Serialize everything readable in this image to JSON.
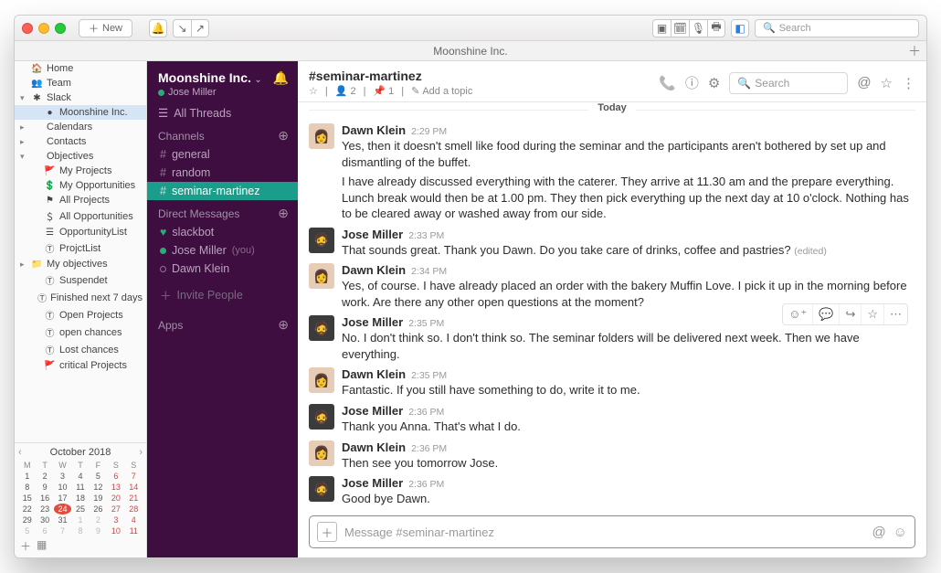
{
  "toolbar": {
    "new_label": "New",
    "search_placeholder": "Search"
  },
  "window_title": "Moonshine Inc.",
  "outline": {
    "items": [
      {
        "label": "Home",
        "icon": "home",
        "level": 0
      },
      {
        "label": "Team",
        "icon": "team",
        "level": 0
      },
      {
        "label": "Slack",
        "icon": "slack",
        "level": 0,
        "expanded": true
      },
      {
        "label": "Moonshine Inc.",
        "icon": "slack-ws",
        "level": 1,
        "selected": true
      },
      {
        "label": "Calendars",
        "icon": "",
        "level": 0,
        "collapsed": true
      },
      {
        "label": "Contacts",
        "icon": "",
        "level": 0,
        "collapsed": true
      },
      {
        "label": "Objectives",
        "icon": "",
        "level": 0,
        "expanded": true
      },
      {
        "label": "My Projects",
        "icon": "flag",
        "level": 1
      },
      {
        "label": "My Opportunities",
        "icon": "dollar",
        "level": 1
      },
      {
        "label": "All Projects",
        "icon": "flag-grey",
        "level": 1
      },
      {
        "label": "All Opportunities",
        "icon": "dollar-grey",
        "level": 1
      },
      {
        "label": "OpportunityList",
        "icon": "list",
        "level": 1
      },
      {
        "label": "ProjctList",
        "icon": "tlist",
        "level": 1
      },
      {
        "label": "My objectives",
        "icon": "folder",
        "level": 0,
        "collapsed": true
      },
      {
        "label": "Suspendet",
        "icon": "tlist",
        "level": 1
      },
      {
        "label": "Finished next 7 days",
        "icon": "tlist",
        "level": 1
      },
      {
        "label": "Open Projects",
        "icon": "tlist",
        "level": 1
      },
      {
        "label": "open chances",
        "icon": "tlist",
        "level": 1
      },
      {
        "label": "Lost chances",
        "icon": "tlist",
        "level": 1
      },
      {
        "label": "critical Projects",
        "icon": "flag-red",
        "level": 1
      }
    ]
  },
  "calendar": {
    "title": "October 2018",
    "dow": [
      "M",
      "T",
      "W",
      "T",
      "F",
      "S",
      "S"
    ],
    "weeks": [
      [
        {
          "d": 1,
          "we": false
        },
        {
          "d": 2
        },
        {
          "d": 3
        },
        {
          "d": 4
        },
        {
          "d": 5
        },
        {
          "d": 6,
          "we": true
        },
        {
          "d": 7,
          "we": true
        }
      ],
      [
        {
          "d": 8
        },
        {
          "d": 9
        },
        {
          "d": 10
        },
        {
          "d": 11
        },
        {
          "d": 12
        },
        {
          "d": 13,
          "we": true
        },
        {
          "d": 14,
          "we": true
        }
      ],
      [
        {
          "d": 15
        },
        {
          "d": 16
        },
        {
          "d": 17
        },
        {
          "d": 18
        },
        {
          "d": 19
        },
        {
          "d": 20,
          "we": true
        },
        {
          "d": 21,
          "we": true
        }
      ],
      [
        {
          "d": 22
        },
        {
          "d": 23
        },
        {
          "d": 24,
          "today": true
        },
        {
          "d": 25
        },
        {
          "d": 26
        },
        {
          "d": 27,
          "we": true
        },
        {
          "d": 28,
          "we": true
        }
      ],
      [
        {
          "d": 29
        },
        {
          "d": 30
        },
        {
          "d": 31
        },
        {
          "d": 1,
          "dim": true
        },
        {
          "d": 2,
          "dim": true
        },
        {
          "d": 3,
          "dim": true,
          "we": true
        },
        {
          "d": 4,
          "dim": true,
          "we": true
        }
      ],
      [
        {
          "d": 5,
          "dim": true
        },
        {
          "d": 6,
          "dim": true
        },
        {
          "d": 7,
          "dim": true
        },
        {
          "d": 8,
          "dim": true
        },
        {
          "d": 9,
          "dim": true
        },
        {
          "d": 10,
          "dim": true,
          "we": true
        },
        {
          "d": 11,
          "dim": true,
          "we": true
        }
      ]
    ]
  },
  "slack": {
    "workspace": "Moonshine Inc.",
    "user": "Jose Miller",
    "all_threads": "All Threads",
    "channels_label": "Channels",
    "channels": [
      {
        "name": "general"
      },
      {
        "name": "random"
      },
      {
        "name": "seminar-martinez",
        "active": true
      }
    ],
    "dm_label": "Direct Messages",
    "dms": [
      {
        "name": "slackbot",
        "icon": "heart"
      },
      {
        "name": "Jose Miller",
        "suffix": "(you)",
        "presence": "on"
      },
      {
        "name": "Dawn Klein",
        "presence": "off"
      }
    ],
    "invite_label": "Invite People",
    "apps_label": "Apps"
  },
  "channel_header": {
    "name": "#seminar-martinez",
    "members": "2",
    "pins": "1",
    "topic": "Add a topic",
    "search_placeholder": "Search"
  },
  "divider_label": "Today",
  "messages": [
    {
      "author": "Dawn Klein",
      "avatar": "dawn",
      "time": "2:29 PM",
      "paragraphs": [
        "Yes, then it doesn't smell like food during the seminar and the participants aren't bothered by set up and dismantling of the buffet.",
        "I have already discussed everything with the caterer. They arrive at 11.30 am and the prepare everything. Lunch break would then be at 1.00 pm. They then pick everything up the next day at 10 o'clock. Nothing has to be cleared away or washed away from our side."
      ]
    },
    {
      "author": "Jose Miller",
      "avatar": "jose",
      "time": "2:33 PM",
      "paragraphs": [
        "That sounds great. Thank you Dawn. Do you take care of drinks, coffee and pastries?"
      ],
      "edited": true
    },
    {
      "author": "Dawn Klein",
      "avatar": "dawn",
      "time": "2:34 PM",
      "paragraphs": [
        "Yes, of course. I have already placed an order with the bakery Muffin Love. I pick it up in the morning before work. Are there any other open questions at the moment?"
      ]
    },
    {
      "author": "Jose Miller",
      "avatar": "jose",
      "time": "2:35 PM",
      "show_actions": true,
      "paragraphs": [
        "No. I don't think so. I don't think so. The seminar folders will be delivered next week. Then we have everything."
      ]
    },
    {
      "author": "Dawn Klein",
      "avatar": "dawn",
      "time": "2:35 PM",
      "paragraphs": [
        "Fantastic. If you still have something to do, write it to me."
      ]
    },
    {
      "author": "Jose Miller",
      "avatar": "jose",
      "time": "2:36 PM",
      "paragraphs": [
        "Thank you Anna. That's what I do."
      ]
    },
    {
      "author": "Dawn Klein",
      "avatar": "dawn",
      "time": "2:36 PM",
      "paragraphs": [
        "Then see you tomorrow Jose."
      ]
    },
    {
      "author": "Jose Miller",
      "avatar": "jose",
      "time": "2:36 PM",
      "paragraphs": [
        "Good bye Dawn."
      ]
    }
  ],
  "composer": {
    "placeholder": "Message #seminar-martinez"
  },
  "edited_label": "(edited)"
}
